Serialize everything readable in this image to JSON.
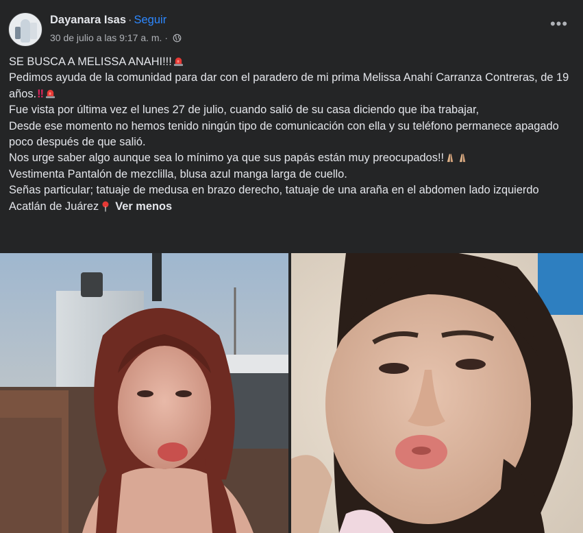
{
  "post": {
    "author": "Dayanara Isas",
    "separator": "·",
    "follow_label": "Seguir",
    "timestamp": "30 de julio a las 9:17 a. m.",
    "meta_separator": "·",
    "privacy_icon": "globe-icon",
    "options_icon": "more-options-icon",
    "options_label": "•••",
    "lines": [
      "SE BUSCA A MELISSA ANAHI!!!",
      "Pedimos ayuda de la comunidad para dar con el paradero de mi prima Melissa Anahí Carranza Contreras, de 19 años.",
      "Fue vista por última vez el lunes 27 de julio, cuando salió de su casa diciendo que iba trabajar,",
      "Desde ese momento no hemos tenido ningún tipo de comunicación con ella y su teléfono permanece apagado poco después de que salió.",
      "Nos urge saber algo aunque sea lo mínimo ya que sus papás están muy preocupados!!",
      "Vestimenta Pantalón de mezclilla, blusa azul manga larga de cuello.",
      "Señas particular; tatuaje de medusa en brazo derecho, tatuaje de una araña en el abdomen lado izquierdo",
      "Acatlán de Juárez"
    ],
    "bang_emoji": "‼",
    "see_less_label": "Ver menos",
    "photos": [
      {
        "name": "photo-left"
      },
      {
        "name": "photo-right"
      }
    ]
  },
  "colors": {
    "background": "#242526",
    "text": "#e4e6eb",
    "secondary_text": "#b0b3b8",
    "link": "#2d88ff"
  }
}
